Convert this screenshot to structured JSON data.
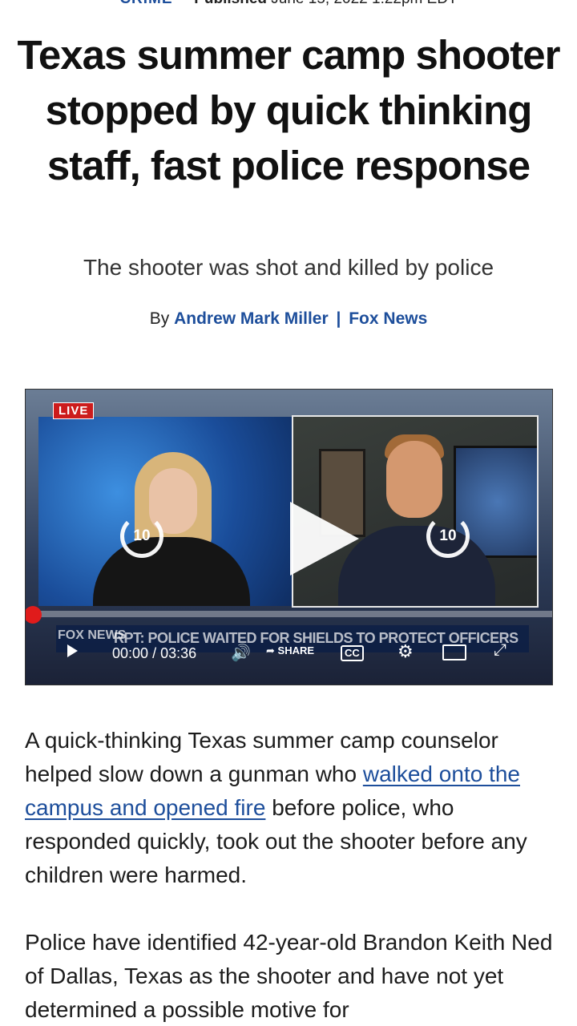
{
  "meta": {
    "category": "CRIME",
    "published": "Published",
    "date": "June 15, 2022 1:22pm EDT"
  },
  "article": {
    "headline": "Texas summer camp shooter stopped by quick thinking staff, fast police response",
    "subheadline": "The shooter was shot and killed by police",
    "byline_prefix": "By",
    "author": "Andrew Mark Miller",
    "separator": "|",
    "outlet": "Fox News"
  },
  "video": {
    "live_badge": "LIVE",
    "skip_back_label": "10",
    "skip_forward_label": "10",
    "chyron": "RPT: POLICE WAITED FOR SHIELDS TO PROTECT OFFICERS",
    "brand": "FOX NEWS",
    "time_current": "00:00",
    "time_separator": "/",
    "time_total": "03:36",
    "share_label": "SHARE",
    "cc_label": "CC",
    "progress": 0
  },
  "paragraphs": {
    "p1_before": "A quick-thinking Texas summer camp counselor helped slow down a gunman who ",
    "p1_link": "walked onto the campus and opened fire",
    "p1_after": " before police, who responded quickly, took out the shooter before any children were harmed.",
    "p2": "Police have identified 42-year-old Brandon Keith Ned of Dallas, Texas as the shooter and have not yet determined a possible motive for"
  },
  "icons": {
    "play": "play-icon",
    "skip_back": "replay-10-icon",
    "skip_forward": "forward-10-icon",
    "volume": "volume-icon",
    "share": "share-icon",
    "captions": "closed-captions-icon",
    "settings": "gear-icon",
    "cast": "cast-icon",
    "fullscreen": "fullscreen-icon"
  },
  "colors": {
    "link": "#1d4e9b",
    "live": "#cc1c1c",
    "progress": "#e01b1b"
  }
}
